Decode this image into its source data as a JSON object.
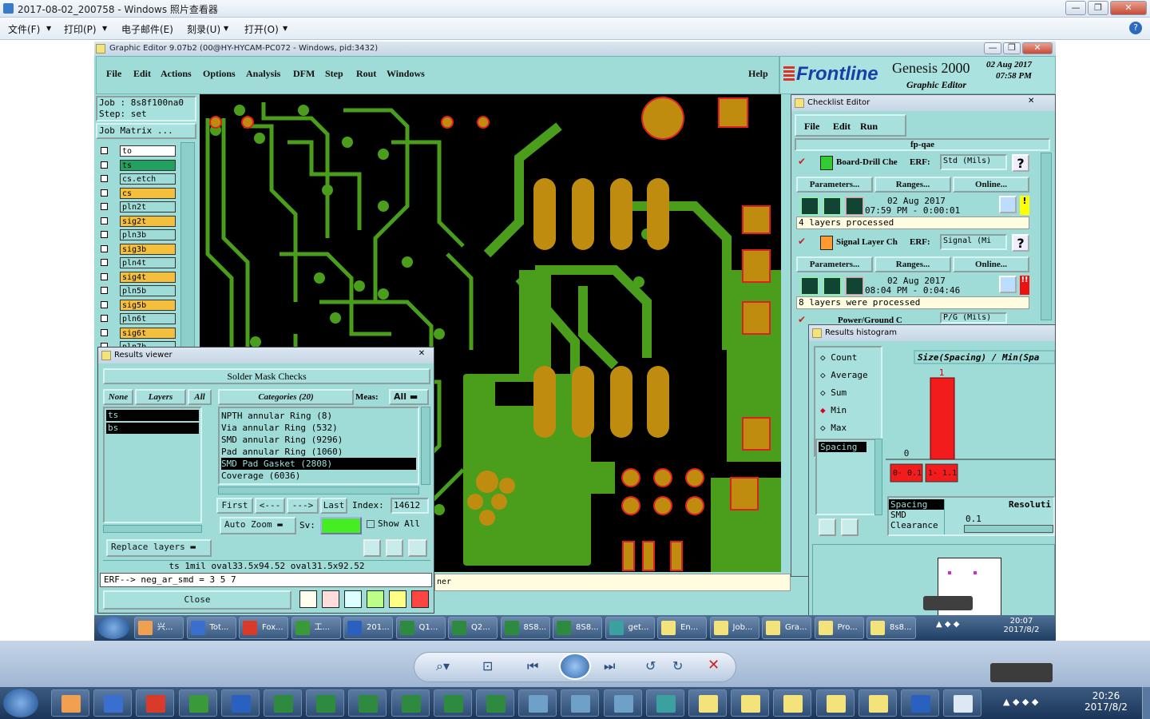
{
  "viewer": {
    "title": "2017-08-02_200758 - Windows 照片查看器",
    "menu": [
      "文件(F)",
      "打印(P)",
      "电子邮件(E)",
      "刻录(U)",
      "打开(O)"
    ]
  },
  "genesis": {
    "title": "Graphic Editor 9.07b2 (00@HY-HYCAM-PC072 - Windows, pid:3432)",
    "menu": [
      "File",
      "Edit",
      "Actions",
      "Options",
      "Analysis",
      "DFM",
      "Step",
      "Rout",
      "Windows"
    ],
    "help": "Help",
    "brand": "Frontline",
    "product": "Genesis 2000",
    "subtitle": "Graphic Editor",
    "date": "02 Aug 2017",
    "time": "07:58 PM",
    "job_label": "Job : 8s8f100na0",
    "step_label": "Step: set",
    "job_matrix": "Job Matrix ...",
    "layers": [
      {
        "name": "to",
        "color": "#ffffff"
      },
      {
        "name": "ts",
        "color": "#22a060"
      },
      {
        "name": "cs.etch",
        "color": "#9fdcd8"
      },
      {
        "name": "cs",
        "color": "#f4bf3c"
      },
      {
        "name": "pln2t",
        "color": "#9fdcd8"
      },
      {
        "name": "sig2t",
        "color": "#f4bf3c"
      },
      {
        "name": "pln3b",
        "color": "#9fdcd8"
      },
      {
        "name": "sig3b",
        "color": "#f4bf3c"
      },
      {
        "name": "pln4t",
        "color": "#9fdcd8"
      },
      {
        "name": "sig4t",
        "color": "#f4bf3c"
      },
      {
        "name": "pln5b",
        "color": "#9fdcd8"
      },
      {
        "name": "sig5b",
        "color": "#f4bf3c"
      },
      {
        "name": "pln6t",
        "color": "#9fdcd8"
      },
      {
        "name": "sig6t",
        "color": "#f4bf3c"
      },
      {
        "name": "pln7b",
        "color": "#9fdcd8"
      }
    ]
  },
  "results_viewer": {
    "title": "Results viewer",
    "header": "Solder Mask Checks",
    "none": "None",
    "layers": "Layers",
    "all": "All",
    "categories": "Categories (20)",
    "meas_label": "Meas:",
    "meas_value": "All",
    "layer_list": [
      "ts",
      "bs"
    ],
    "category_list": [
      "NPTH annular Ring (8)",
      "Via annular Ring (532)",
      "SMD annular Ring (9296)",
      "Pad annular Ring (1060)",
      "SMD Pad Gasket (2808)",
      "Coverage (6036)"
    ],
    "selected_category": "SMD Pad Gasket (2808)",
    "first": "First",
    "prev": "<---",
    "next": "--->",
    "last": "Last",
    "index_label": "Index:",
    "index_value": "14612",
    "auto_zoom": "Auto Zoom",
    "sv_label": "Sv:",
    "show_all": "Show All",
    "replace_layers": "Replace layers",
    "status": "ts 1mil  oval33.5x94.52  oval31.5x92.52",
    "erf": "ERF--> neg_ar_smd = 3 5 7",
    "close": "Close",
    "trail": "ner"
  },
  "checklist": {
    "title": "Checklist Editor",
    "menu": [
      "File",
      "Edit",
      "Run"
    ],
    "name": "fp-qae",
    "erf_label": "ERF:",
    "params": "Parameters...",
    "ranges": "Ranges...",
    "online": "Online...",
    "items": [
      {
        "name": "Board-Drill Che",
        "erf": "Std (Mils)",
        "date": "02 Aug 2017",
        "time": "07:59 PM - 0:00:01",
        "status": "4 layers processed",
        "flag": "!"
      },
      {
        "name": "Signal Layer Ch",
        "erf": "Signal (Mi",
        "date": "02 Aug 2017",
        "time": "08:04 PM - 0:04:46",
        "status": "8 layers were processed",
        "flag": "!!"
      },
      {
        "name": "Power/Ground C",
        "erf": "P/G (Mils)",
        "date": "",
        "time": "",
        "status": "",
        "flag": ""
      }
    ]
  },
  "histogram": {
    "title": "Results histogram",
    "modes": [
      "Count",
      "Average",
      "Sum",
      "Min",
      "Max"
    ],
    "selected_mode": "Min",
    "chart_title": "Size(Spacing) / Min(Spa",
    "spacing": "Spacing",
    "list": [
      "Spacing",
      "SMD",
      "Clearance"
    ],
    "resolution_label": "Resoluti",
    "resolution_value": "0.1",
    "chart_data": {
      "type": "bar",
      "categories": [
        "0- 0.1",
        "1- 1.1"
      ],
      "values": [
        0,
        1
      ],
      "title": "Size(Spacing) / Min(Spa"
    }
  },
  "taskbar_inner": {
    "items": [
      "兴...",
      "Tot...",
      "Fox...",
      "工...",
      "201...",
      "Q1...",
      "Q2...",
      "8S8...",
      "8S8...",
      "get...",
      "En...",
      "Job...",
      "Gra...",
      "Pro...",
      "8s8..."
    ],
    "time": "20:07",
    "date": "2017/8/2"
  },
  "taskbar_outer": {
    "time": "20:26",
    "date": "2017/8/2"
  }
}
